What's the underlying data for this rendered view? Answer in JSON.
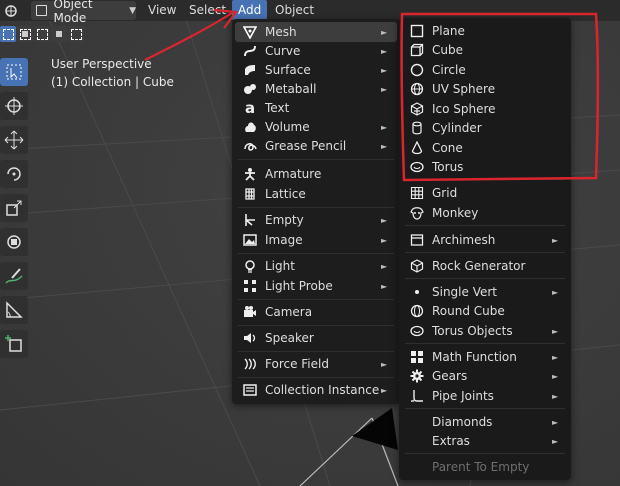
{
  "header": {
    "mode": "Object Mode",
    "menus": [
      "View",
      "Select",
      "Add",
      "Object"
    ]
  },
  "overlay": {
    "line1": "User Perspective",
    "line2": "(1) Collection | Cube"
  },
  "add_menu": {
    "items": [
      {
        "label": "Mesh",
        "icon": "mesh-icon",
        "submenu": true
      },
      {
        "label": "Curve",
        "icon": "curve-icon",
        "submenu": true
      },
      {
        "label": "Surface",
        "icon": "surface-icon",
        "submenu": true
      },
      {
        "label": "Metaball",
        "icon": "metaball-icon",
        "submenu": true
      },
      {
        "label": "Text",
        "icon": "text-icon",
        "submenu": false
      },
      {
        "label": "Volume",
        "icon": "volume-icon",
        "submenu": true
      },
      {
        "label": "Grease Pencil",
        "icon": "grease-pencil-icon",
        "submenu": true
      },
      {
        "label": "Armature",
        "icon": "armature-icon",
        "submenu": false
      },
      {
        "label": "Lattice",
        "icon": "lattice-icon",
        "submenu": false
      },
      {
        "label": "Empty",
        "icon": "empty-icon",
        "submenu": true
      },
      {
        "label": "Image",
        "icon": "image-icon",
        "submenu": true
      },
      {
        "label": "Light",
        "icon": "light-icon",
        "submenu": true
      },
      {
        "label": "Light Probe",
        "icon": "light-probe-icon",
        "submenu": true
      },
      {
        "label": "Camera",
        "icon": "camera-icon",
        "submenu": false
      },
      {
        "label": "Speaker",
        "icon": "speaker-icon",
        "submenu": false
      },
      {
        "label": "Force Field",
        "icon": "force-field-icon",
        "submenu": true
      },
      {
        "label": "Collection Instance",
        "icon": "collection-instance-icon",
        "submenu": true
      }
    ]
  },
  "mesh_menu": {
    "items": [
      {
        "label": "Plane",
        "icon": "plane-icon",
        "submenu": false
      },
      {
        "label": "Cube",
        "icon": "cube-icon",
        "submenu": false
      },
      {
        "label": "Circle",
        "icon": "circle-icon",
        "submenu": false
      },
      {
        "label": "UV Sphere",
        "icon": "uv-sphere-icon",
        "submenu": false
      },
      {
        "label": "Ico Sphere",
        "icon": "ico-sphere-icon",
        "submenu": false
      },
      {
        "label": "Cylinder",
        "icon": "cylinder-icon",
        "submenu": false
      },
      {
        "label": "Cone",
        "icon": "cone-icon",
        "submenu": false
      },
      {
        "label": "Torus",
        "icon": "torus-icon",
        "submenu": false
      },
      {
        "label": "Grid",
        "icon": "grid-icon",
        "submenu": false
      },
      {
        "label": "Monkey",
        "icon": "monkey-icon",
        "submenu": false
      },
      {
        "label": "Archimesh",
        "icon": "archimesh-icon",
        "submenu": true
      },
      {
        "label": "Rock Generator",
        "icon": "rock-generator-icon",
        "submenu": false
      },
      {
        "label": "Single Vert",
        "icon": "single-vert-icon",
        "submenu": true
      },
      {
        "label": "Round Cube",
        "icon": "round-cube-icon",
        "submenu": false
      },
      {
        "label": "Torus Objects",
        "icon": "torus-objects-icon",
        "submenu": true
      },
      {
        "label": "Math Function",
        "icon": "math-function-icon",
        "submenu": true
      },
      {
        "label": "Gears",
        "icon": "gears-icon",
        "submenu": true
      },
      {
        "label": "Pipe Joints",
        "icon": "pipe-joints-icon",
        "submenu": true
      },
      {
        "label": "Diamonds",
        "icon": "",
        "submenu": true
      },
      {
        "label": "Extras",
        "icon": "",
        "submenu": true
      },
      {
        "label": "Parent To Empty",
        "icon": "",
        "submenu": false,
        "disabled": true
      }
    ]
  },
  "colors": {
    "accent": "#4772b3",
    "menu_bg": "#1d1d1d",
    "annotation": "#d8262c"
  }
}
